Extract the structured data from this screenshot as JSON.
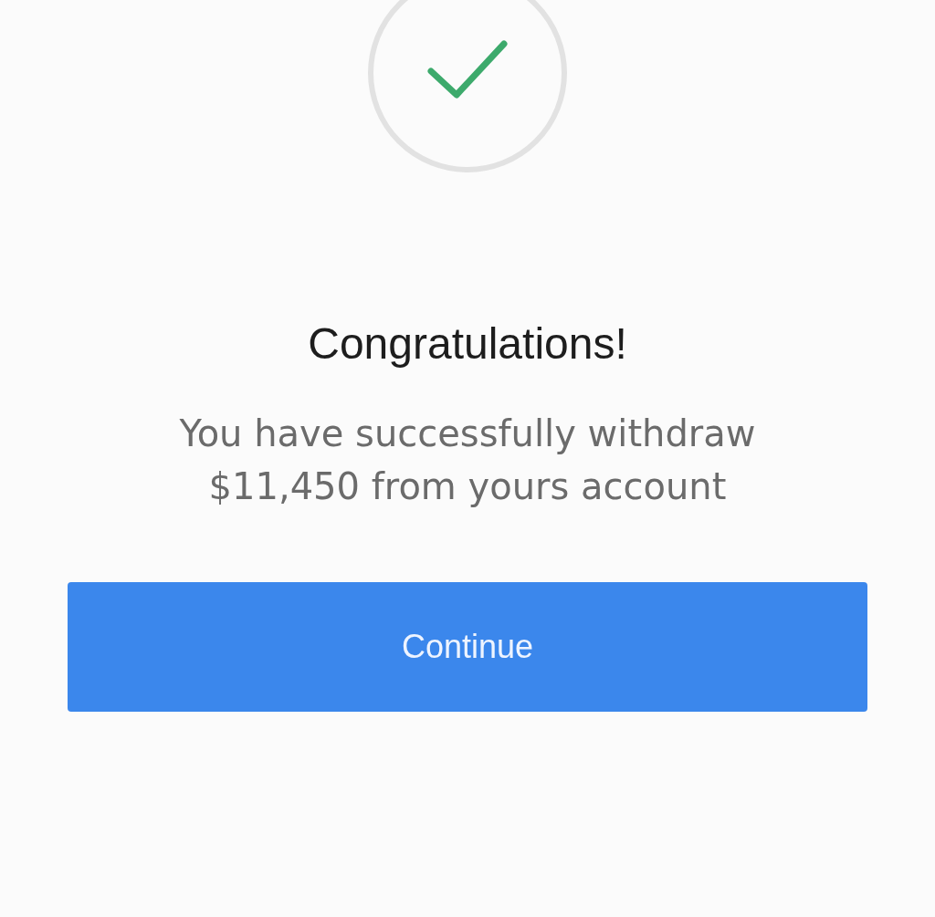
{
  "title": "Congratulations!",
  "message": "You have successfully withdraw\n$11,450 from yours account",
  "button": {
    "label": "Continue"
  }
}
